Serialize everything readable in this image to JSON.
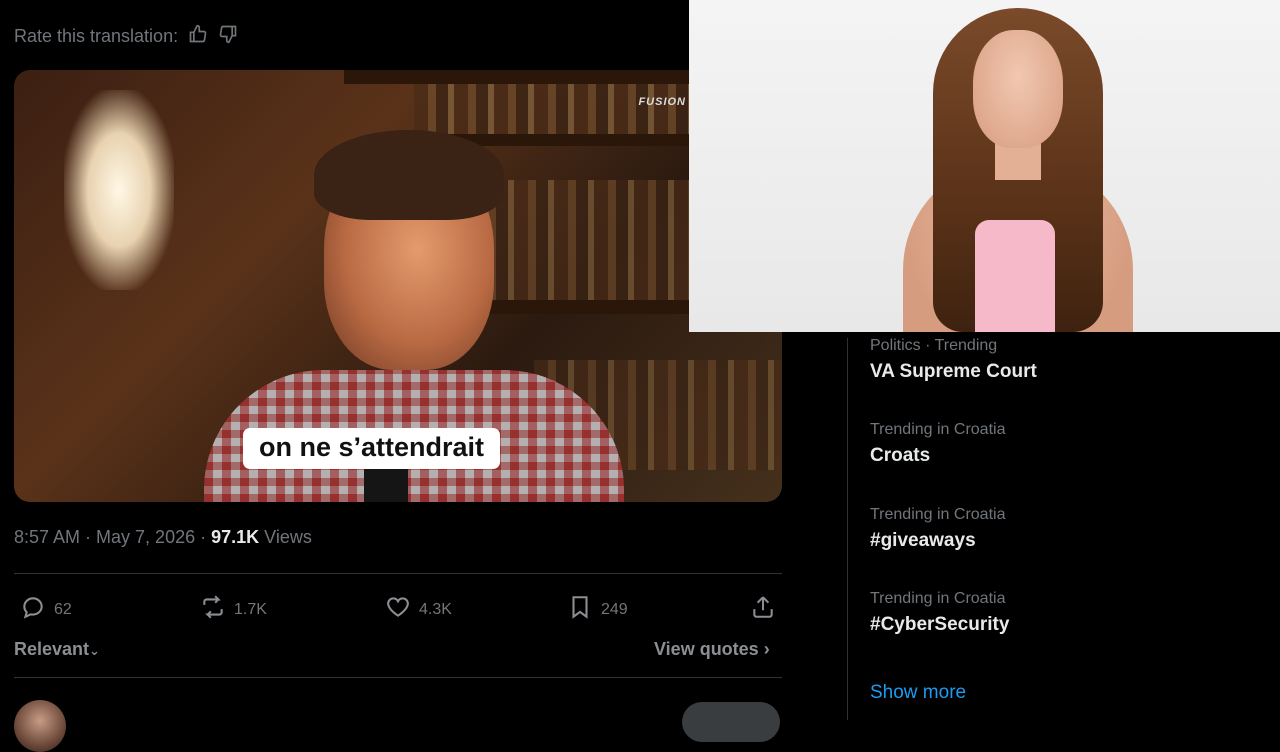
{
  "tweet": {
    "rate_translation_label": "Rate this translation:",
    "video": {
      "caption": "on ne s’attendrait",
      "watermark": "FUSION"
    },
    "meta": {
      "time_date": "8:57 AM · May 7, 2026 · ",
      "views_count": "97.1K",
      "views_label": " Views"
    },
    "actions": {
      "replies": "62",
      "reposts": "1.7K",
      "likes": "4.3K",
      "bookmarks": "249"
    },
    "sort_label": "Relevant",
    "view_quotes_label": "View quotes"
  },
  "trends": {
    "items": [
      {
        "category": "Politics · Trending",
        "name": "VA Supreme Court"
      },
      {
        "category": "Trending in Croatia",
        "name": "Croats"
      },
      {
        "category": "Trending in Croatia",
        "name": "#giveaways"
      },
      {
        "category": "Trending in Croatia",
        "name": "#CyberSecurity"
      }
    ],
    "show_more": "Show more"
  },
  "icons": {
    "reply": "reply-icon",
    "repost": "repost-icon",
    "like": "heart-icon",
    "bookmark": "bookmark-icon",
    "share": "share-icon",
    "thumbs_up": "thumbs-up-icon",
    "thumbs_down": "thumbs-down-icon"
  },
  "colors": {
    "background": "#000000",
    "muted_text": "#71767b",
    "link": "#1d9bf0",
    "divider": "#2f3336"
  }
}
